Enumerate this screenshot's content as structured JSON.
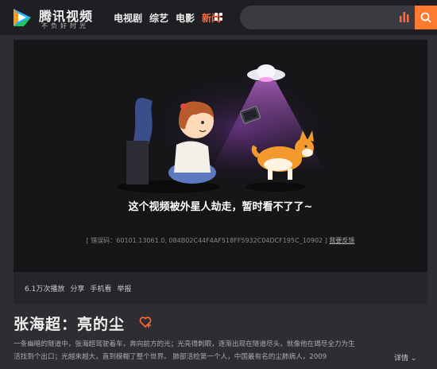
{
  "header": {
    "logo_text": "腾讯视频",
    "slogan": "不负好时光",
    "nav": [
      "电视剧",
      "综艺",
      "电影",
      "新闻"
    ],
    "search_placeholder": ""
  },
  "player": {
    "error_title": "这个视频被外星人劫走，暂时看不了了~",
    "error_code_prefix": "[ 错误码：60101.13061.0, 084B02C44F4AF518FF5932C04DCF195C_10902 ]",
    "feedback_label": "我要反馈"
  },
  "stats": {
    "plays": "6.1万次播放",
    "share": "分享",
    "mobile": "手机看",
    "report": "举报"
  },
  "video": {
    "title": "张海超：亮的尘",
    "description_lines": [
      "一条幽暗的隧道中，张海超驾驶着车，奔向前方的光；光亮得刺眼，逐渐出现在隧道尽头，就像他在竭尽全力为生",
      "活找到个出口；光越来越大，直到模糊了整个世界。 肺部活检第一个人，中国最有名的尘肺病人，2009"
    ],
    "detail_label": "详情"
  },
  "colors": {
    "accent": "#ff6a3a",
    "search_button": "#ff7a2e"
  }
}
